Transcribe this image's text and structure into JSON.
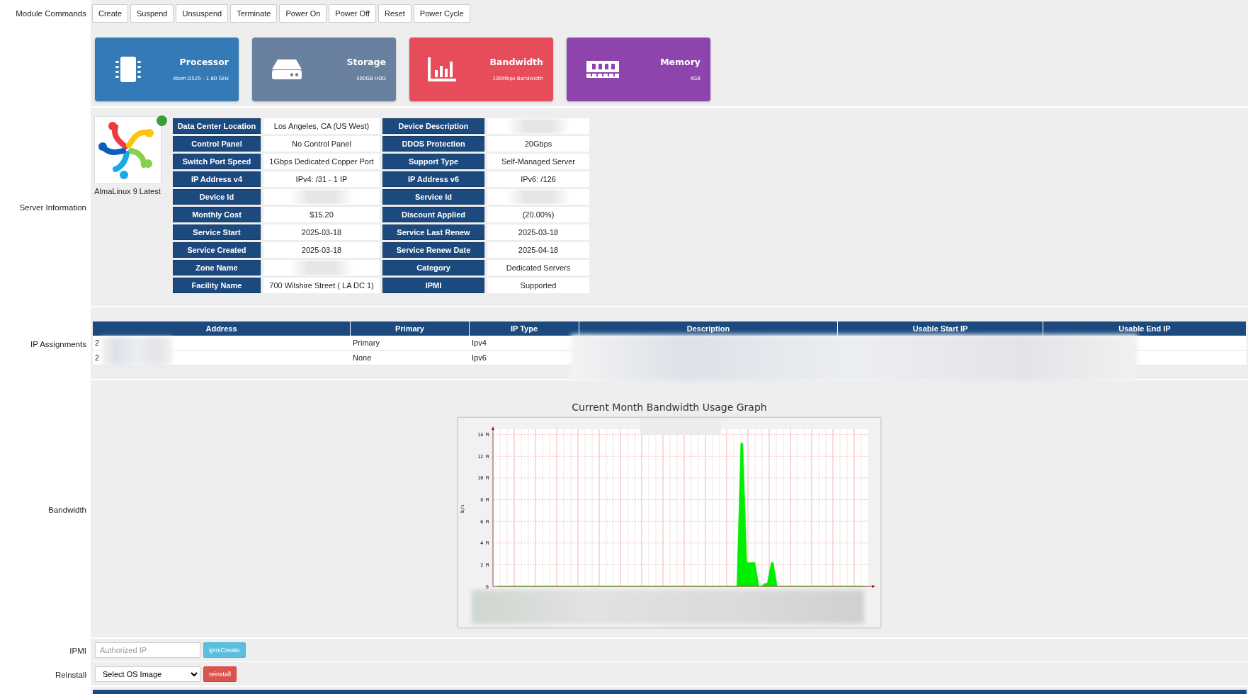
{
  "module_commands": {
    "label": "Module Commands",
    "buttons": [
      "Create",
      "Suspend",
      "Unsuspend",
      "Terminate",
      "Power On",
      "Power Off",
      "Reset",
      "Power Cycle"
    ]
  },
  "cards": [
    {
      "kind": "cpu",
      "title": "Processor",
      "subtitle": "Atom D525 - 1.80 GHz",
      "color": "#337ab7"
    },
    {
      "kind": "storage",
      "title": "Storage",
      "subtitle": "500GB HDD",
      "color": "#69819f"
    },
    {
      "kind": "bandwidth",
      "title": "Bandwidth",
      "subtitle": "100Mbps Bandwidth",
      "color": "#e74c5a"
    },
    {
      "kind": "memory",
      "title": "Memory",
      "subtitle": "4GB",
      "color": "#8e44ad"
    }
  ],
  "server_information": {
    "label": "Server Information",
    "os_name": "AlmaLinux 9 Latest",
    "online": true,
    "rows": [
      {
        "label": "Data Center Location",
        "value": "Los Angeles, CA (US West)",
        "label_2": "Device Description",
        "redacted_2": true
      },
      {
        "label": "Control Panel",
        "value": "No Control Panel",
        "label_2": "DDOS Protection",
        "value_2": "20Gbps"
      },
      {
        "label": "Switch Port Speed",
        "value": "1Gbps Dedicated Copper Port",
        "label_2": "Support Type",
        "value_2": "Self-Managed Server"
      },
      {
        "label": "IP Address v4",
        "value": "IPv4: /31 - 1 IP",
        "label_2": "IP Address v6",
        "value_2": "IPv6: /126"
      },
      {
        "label": "Device Id",
        "redacted": true,
        "label_2": "Service Id",
        "redacted_2": true
      },
      {
        "label": "Monthly Cost",
        "value": "$15.20",
        "label_2": "Discount Applied",
        "value_2": "(20.00%)"
      },
      {
        "label": "Service Start",
        "value": "2025-03-18",
        "label_2": "Service Last Renew",
        "value_2": "2025-03-18"
      },
      {
        "label": "Service Created",
        "value": "2025-03-18",
        "label_2": "Service Renew Date",
        "value_2": "2025-04-18"
      },
      {
        "label": "Zone Name",
        "redacted": true,
        "label_2": "Category",
        "value_2": "Dedicated Servers"
      },
      {
        "label": "Facility Name",
        "value": "700 Wilshire Street ( LA DC 1)",
        "label_2": "IPMI",
        "value_2": "Supported"
      }
    ]
  },
  "ip_assignments": {
    "label": "IP Assignments",
    "columns": [
      "Address",
      "Primary",
      "IP Type",
      "Description",
      "Usable Start IP",
      "Usable End IP"
    ],
    "rows": [
      {
        "address": "2",
        "primary": "Primary",
        "ip_type": "Ipv4"
      },
      {
        "address": "2",
        "primary": "None",
        "ip_type": "Ipv6"
      }
    ]
  },
  "bandwidth": {
    "label": "Bandwidth",
    "title": "Current Month Bandwidth Usage Graph",
    "chart_data": {
      "type": "area",
      "ylabel": "b/s",
      "ylim": [
        0,
        14.5
      ],
      "grid": true,
      "yticks": [
        {
          "value": 0,
          "label": "0"
        },
        {
          "value": 2,
          "label": "2 M"
        },
        {
          "value": 4,
          "label": "4 M"
        },
        {
          "value": 6,
          "label": "6 M"
        },
        {
          "value": 8,
          "label": "8 M"
        },
        {
          "value": 10,
          "label": "10 M"
        },
        {
          "value": 12,
          "label": "12 M"
        },
        {
          "value": 14,
          "label": "14 M"
        }
      ],
      "series": [
        {
          "color": "#00ee00",
          "values": [
            0,
            0,
            0,
            0,
            0,
            0,
            0,
            0,
            0,
            0,
            0,
            0,
            0,
            0,
            0,
            0,
            0,
            0,
            0,
            0,
            0,
            0,
            0,
            0,
            0,
            0,
            0,
            0,
            0,
            0,
            0,
            0,
            0,
            0,
            0,
            0,
            0,
            0,
            0,
            0,
            13.2,
            2.2,
            2.2,
            0,
            0.3,
            2.2,
            0,
            0,
            0,
            0,
            0,
            0,
            0,
            0,
            0,
            0,
            0,
            0,
            0,
            0,
            0
          ]
        }
      ]
    }
  },
  "ipmi": {
    "label": "IPMI",
    "placeholder": "Authorized IP",
    "button": "ipmiCreate"
  },
  "reinstall": {
    "label": "Reinstall",
    "select": "Select OS Image",
    "button": "reinstall"
  }
}
